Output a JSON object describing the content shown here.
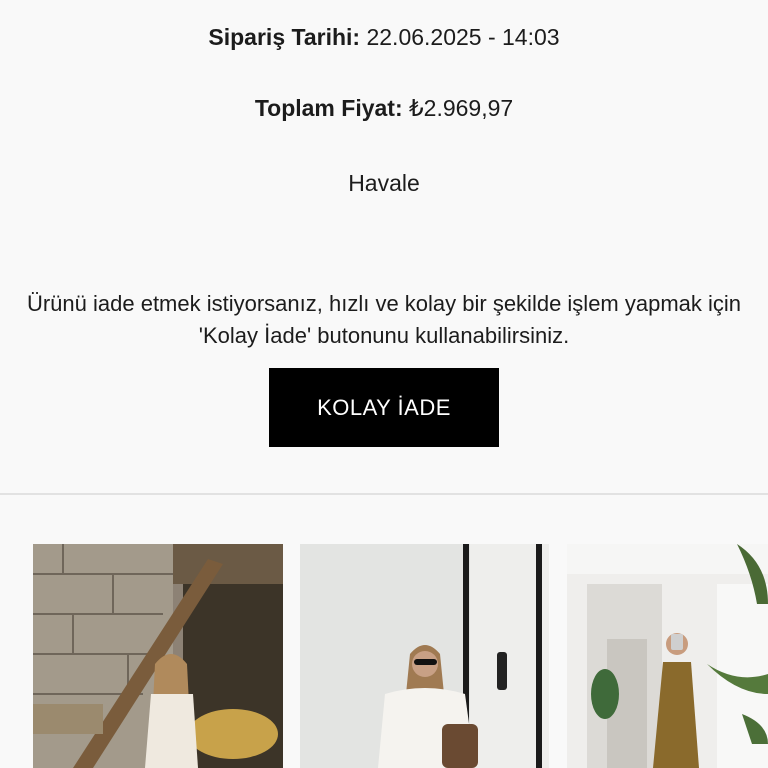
{
  "order": {
    "date_label": "Sipariş Tarihi:",
    "date_value": "22.06.2025 - 14:03",
    "total_label": "Toplam Fiyat:",
    "total_value": "₺2.969,97",
    "payment_method": "Havale"
  },
  "return_section": {
    "info_text": "Ürünü iade etmek istiyorsanız, hızlı ve kolay bir şekilde işlem yapmak için 'Kolay İade' butonunu kullanabilirsiniz.",
    "button_label": "KOLAY İADE"
  },
  "products": [
    {
      "image": "woman-white-outfit-stone-wall-photo"
    },
    {
      "image": "woman-white-knit-top-door-photo"
    },
    {
      "image": "woman-brown-maxi-dress-mirror-selfie-photo"
    }
  ],
  "colors": {
    "background": "#f9f9f9",
    "button_bg": "#000000",
    "button_text": "#ffffff",
    "divider": "#e2e2e2"
  }
}
